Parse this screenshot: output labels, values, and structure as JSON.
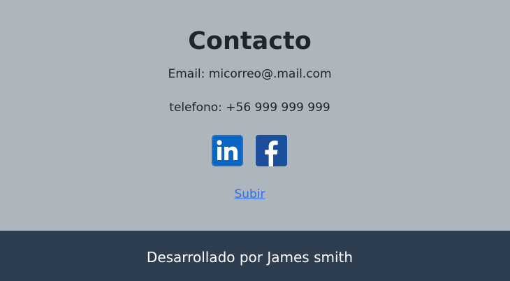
{
  "contact": {
    "title": "Contacto",
    "email_text": "Email: micorreo@.mail.com",
    "phone_text": "telefono: +56 999 999 999",
    "up_link_label": "Subir"
  },
  "socials": [
    {
      "icon": "linkedin-icon",
      "color": "#0a66c2"
    },
    {
      "icon": "facebook-icon",
      "color": "#1b4f9c"
    }
  ],
  "footer": {
    "text": "Desarrollado por James smith"
  },
  "colors": {
    "page_background": "#adb5bd",
    "footer_background": "#2c3e50",
    "link": "#2f6fe8",
    "text": "#212529"
  }
}
